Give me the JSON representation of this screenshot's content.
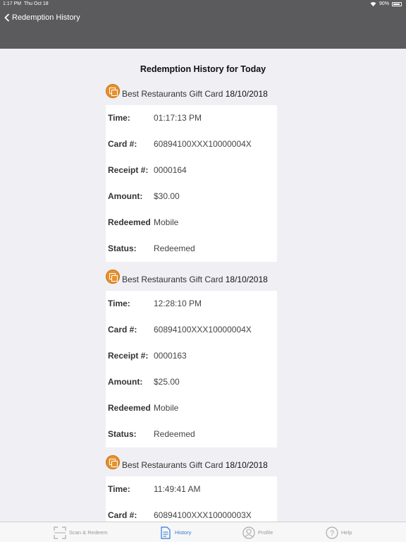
{
  "status": {
    "time": "1:17 PM",
    "date": "Thu Oct 18",
    "battery": "90%"
  },
  "nav": {
    "back_label": "Redemption History"
  },
  "page": {
    "title": "Redemption History for Today"
  },
  "labels": {
    "time": "Time:",
    "card": "Card #:",
    "receipt": "Receipt #:",
    "amount": "Amount:",
    "redeemed": "Redeemed",
    "status": "Status:"
  },
  "records": [
    {
      "card_name": "Best Restaurants Gift Card",
      "date": "18/10/2018",
      "time": "01:17:13 PM",
      "card_no": "60894100XXX10000004X",
      "receipt": "0000164",
      "amount": "$30.00",
      "redeemed": "Mobile",
      "status": "Redeemed"
    },
    {
      "card_name": "Best Restaurants Gift Card",
      "date": "18/10/2018",
      "time": "12:28:10 PM",
      "card_no": "60894100XXX10000004X",
      "receipt": "0000163",
      "amount": "$25.00",
      "redeemed": "Mobile",
      "status": "Redeemed"
    },
    {
      "card_name": "Best Restaurants Gift Card",
      "date": "18/10/2018",
      "time": "11:49:41 AM",
      "card_no": "60894100XXX10000003X"
    }
  ],
  "tabs": [
    {
      "label": "Scan & Redeem",
      "icon": "scan-icon"
    },
    {
      "label": "History",
      "icon": "history-icon",
      "active": true
    },
    {
      "label": "Profile",
      "icon": "profile-icon"
    },
    {
      "label": "Help",
      "icon": "help-icon"
    }
  ],
  "colors": {
    "nav": "#5b5b5d",
    "accent": "#2f7ad8",
    "card_icon": "#e8912b",
    "background": "#efeff4"
  }
}
